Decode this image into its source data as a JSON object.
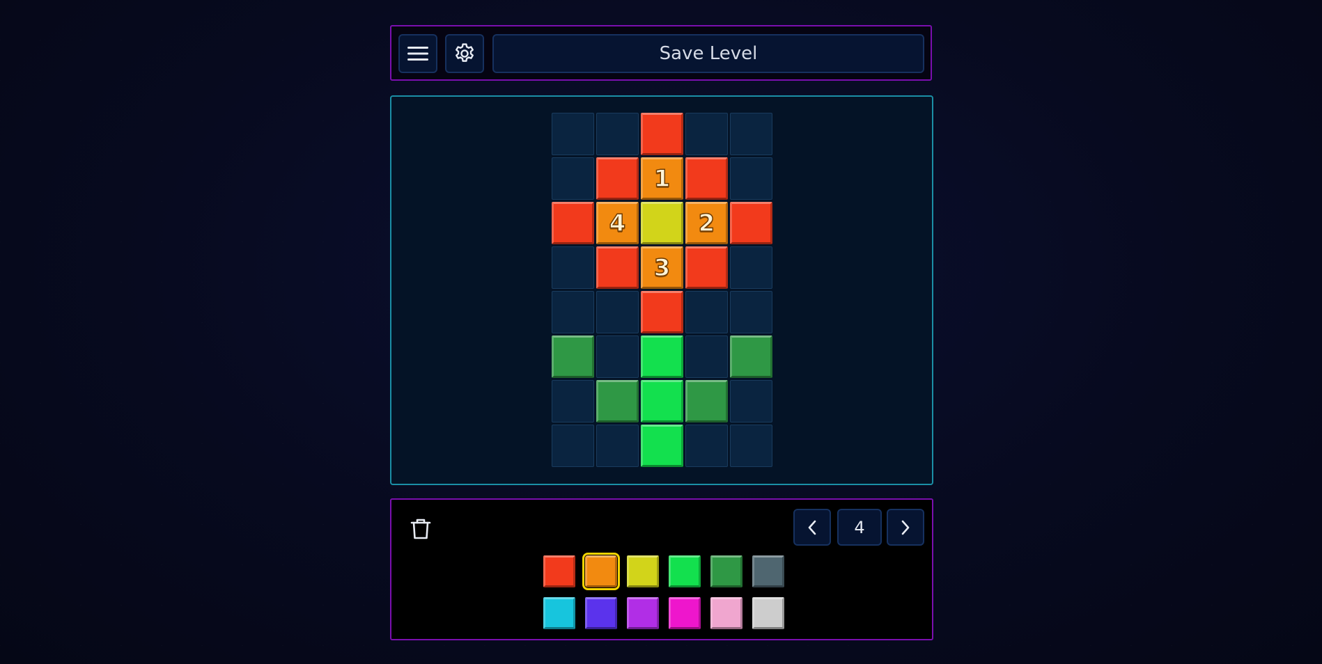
{
  "toolbar": {
    "menu_icon": "hamburger-menu-icon",
    "settings_icon": "gear-icon",
    "save_label": "Save Level"
  },
  "colors": {
    "red": "#f23a1c",
    "orange": "#f28a10",
    "yellow": "#d2d41a",
    "bright_green": "#13e04e",
    "dark_green": "#2f9845",
    "slate": "#4f6670",
    "cyan": "#17c5dd",
    "blue_violet": "#5b33ec",
    "purple": "#b12ee6",
    "magenta": "#ee16cc",
    "pink": "#f0a6cf",
    "silver": "#cdcdcd"
  },
  "board": {
    "columns": 5,
    "rows": 8,
    "cells": [
      [
        null,
        null,
        {
          "color": "red"
        },
        null,
        null
      ],
      [
        null,
        {
          "color": "red"
        },
        {
          "color": "orange",
          "label": "1"
        },
        {
          "color": "red"
        },
        null
      ],
      [
        {
          "color": "red"
        },
        {
          "color": "orange",
          "label": "4"
        },
        {
          "color": "yellow"
        },
        {
          "color": "orange",
          "label": "2"
        },
        {
          "color": "red"
        }
      ],
      [
        null,
        {
          "color": "red"
        },
        {
          "color": "orange",
          "label": "3"
        },
        {
          "color": "red"
        },
        null
      ],
      [
        null,
        null,
        {
          "color": "red"
        },
        null,
        null
      ],
      [
        {
          "color": "dark_green"
        },
        null,
        {
          "color": "bright_green"
        },
        null,
        {
          "color": "dark_green"
        }
      ],
      [
        null,
        {
          "color": "dark_green"
        },
        {
          "color": "bright_green"
        },
        {
          "color": "dark_green"
        },
        null
      ],
      [
        null,
        null,
        {
          "color": "bright_green"
        },
        null,
        null
      ]
    ]
  },
  "controls": {
    "trash_icon": "trash-icon",
    "prev_icon": "chevron-left-icon",
    "next_icon": "chevron-right-icon",
    "level_number": "4"
  },
  "palette": {
    "selected": "orange",
    "rows": [
      [
        "red",
        "orange",
        "yellow",
        "bright_green",
        "dark_green",
        "slate"
      ],
      [
        "cyan",
        "blue_violet",
        "purple",
        "magenta",
        "pink",
        "silver"
      ]
    ]
  }
}
